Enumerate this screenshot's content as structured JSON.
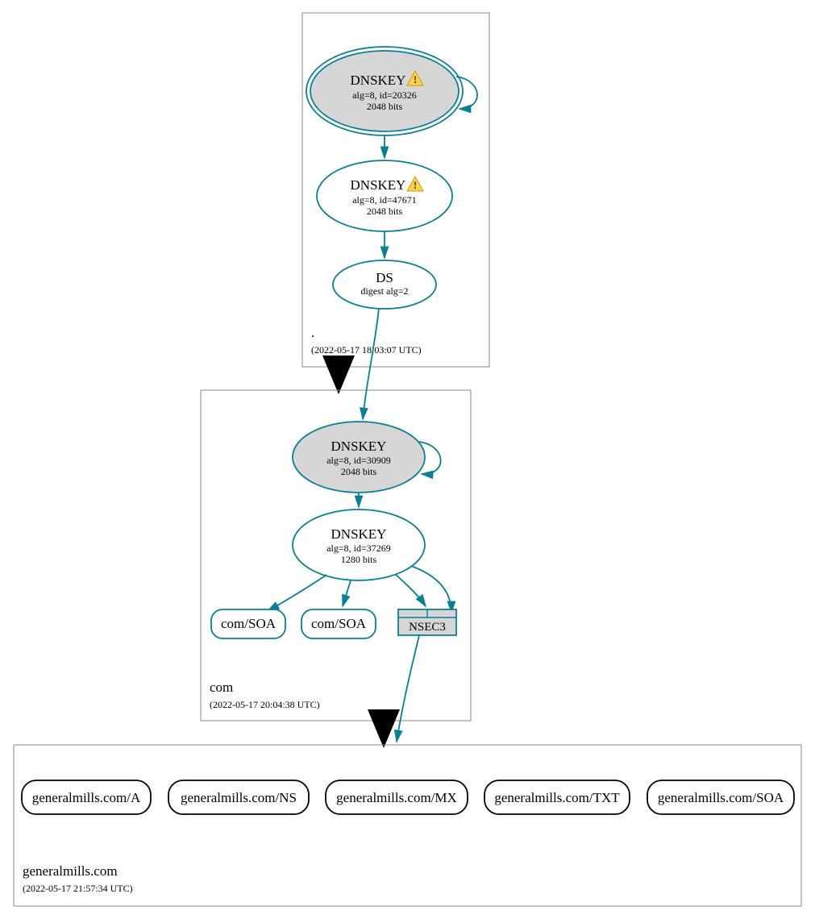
{
  "colors": {
    "teal": "#097f96",
    "grey": "#d6d6d6"
  },
  "zones": {
    "root": {
      "name": ".",
      "timestamp": "(2022-05-17 18:03:07 UTC)"
    },
    "com": {
      "name": "com",
      "timestamp": "(2022-05-17 20:04:38 UTC)"
    },
    "leaf": {
      "name": "generalmills.com",
      "timestamp": "(2022-05-17 21:57:34 UTC)"
    }
  },
  "root_nodes": {
    "ksk": {
      "title": "DNSKEY",
      "line1": "alg=8, id=20326",
      "line2": "2048 bits",
      "warning": true
    },
    "zsk": {
      "title": "DNSKEY",
      "line1": "alg=8, id=47671",
      "line2": "2048 bits",
      "warning": true
    },
    "ds": {
      "title": "DS",
      "line1": "digest alg=2"
    }
  },
  "com_nodes": {
    "ksk": {
      "title": "DNSKEY",
      "line1": "alg=8, id=30909",
      "line2": "2048 bits"
    },
    "zsk": {
      "title": "DNSKEY",
      "line1": "alg=8, id=37269",
      "line2": "1280 bits"
    },
    "soa1": "com/SOA",
    "soa2": "com/SOA",
    "nsec3": "NSEC3"
  },
  "leaf_records": {
    "a": "generalmills.com/A",
    "ns": "generalmills.com/NS",
    "mx": "generalmills.com/MX",
    "txt": "generalmills.com/TXT",
    "soa": "generalmills.com/SOA"
  }
}
